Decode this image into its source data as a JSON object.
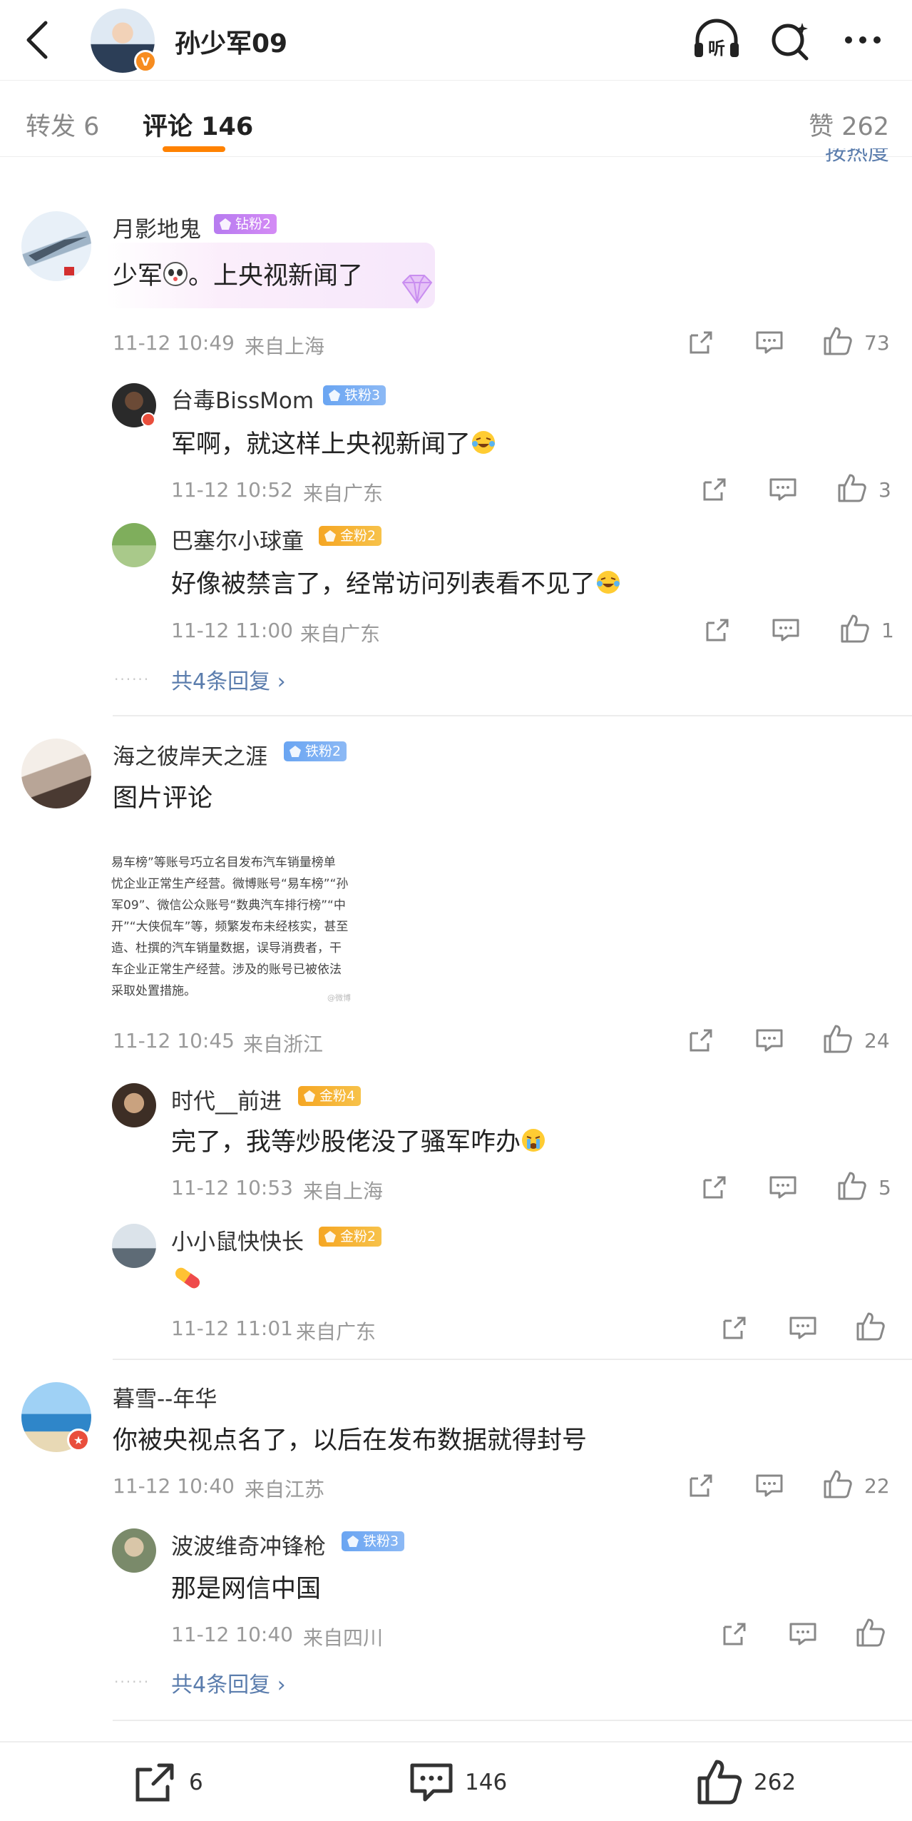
{
  "header": {
    "title": "孙少军09",
    "verified_badge": "V",
    "listen_label": "听"
  },
  "tabs": {
    "repost_label": "转发 6",
    "comment_label": "评论 146",
    "like_label": "赞 262",
    "sort_label": "按热度"
  },
  "comments": [
    {
      "user": "月影地鬼",
      "badge": "钻粉2",
      "text": "少军",
      "text_tail": "。上央视新闻了",
      "time": "11-12 10:49",
      "location": "来自上海",
      "likes": "73",
      "replies": [
        {
          "user": "台毒BissMom",
          "badge": "铁粉3",
          "text": "军啊，就这样上央视新闻了",
          "time": "11-12 10:52",
          "location": "来自广东",
          "likes": "3"
        },
        {
          "user": "巴塞尔小球童",
          "badge": "金粉2",
          "text": "好像被禁言了，经常访问列表看不见了",
          "time": "11-12 11:00",
          "location": "来自广东",
          "likes": "1"
        }
      ],
      "more_replies": "共4条回复"
    },
    {
      "user": "海之彼岸天之涯",
      "badge": "铁粉2",
      "text": "图片评论",
      "image_lines": [
        "易车榜”等账号巧立名目发布汽车销量榜单",
        "忧企业正常生产经营。微博账号“易车榜”“孙",
        "军09”、微信公众账号“数典汽车排行榜”“中",
        "开”“大侠侃车”等，频繁发布未经核实，甚至",
        "造、杜撰的汽车销量数据，误导消费者，干",
        "车企业正常生产经营。涉及的账号已被依法",
        "采取处置措施。"
      ],
      "image_watermark": "@微博",
      "time": "11-12 10:45",
      "location": "来自浙江",
      "likes": "24",
      "replies": [
        {
          "user": "时代__前进",
          "badge": "金粉4",
          "text": "完了，我等炒股佬没了骚军咋办",
          "time": "11-12 10:53",
          "location": "来自上海",
          "likes": "5"
        },
        {
          "user": "小小鼠快快长",
          "badge": "金粉2",
          "text": "",
          "time": "11-12 11:01",
          "location": "来自广东",
          "likes": ""
        }
      ]
    },
    {
      "user": "暮雪--年华",
      "text": "你被央视点名了，以后在发布数据就得封号",
      "time": "11-12 10:40",
      "location": "来自江苏",
      "likes": "22",
      "replies": [
        {
          "user": "波波维奇冲锋枪",
          "badge": "铁粉3",
          "text": "那是网信中国",
          "time": "11-12 10:40",
          "location": "来自四川",
          "likes": ""
        }
      ],
      "more_replies": "共4条回复"
    }
  ],
  "bottom_bar": {
    "repost_count": "6",
    "comment_count": "146",
    "like_count": "262"
  },
  "colors": {
    "accent": "#ff8200",
    "link": "#5b7dad",
    "meta": "#9a9a9a"
  }
}
